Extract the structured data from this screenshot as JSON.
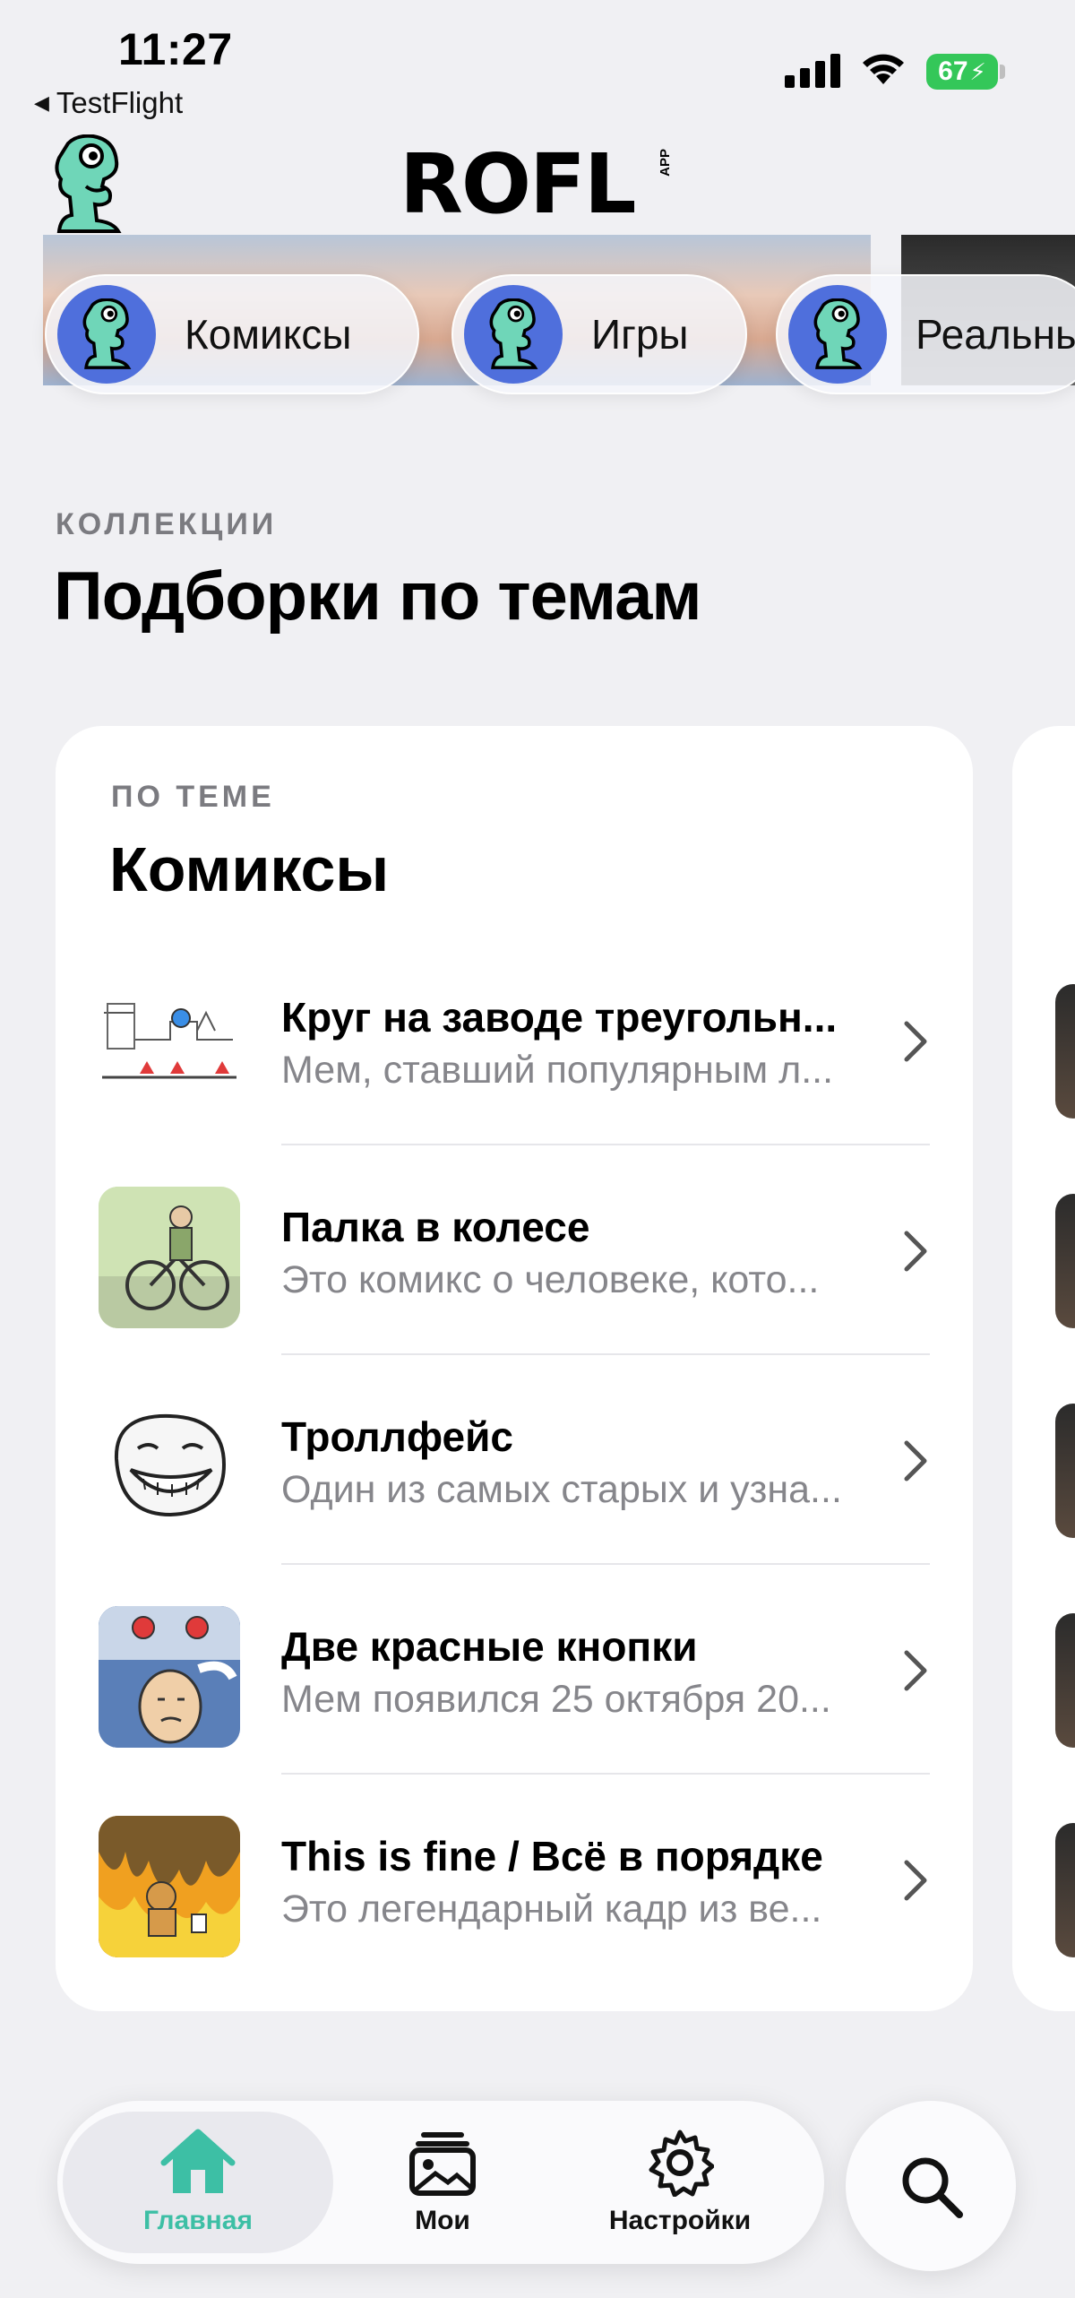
{
  "status_bar": {
    "time": "11:27",
    "back_app": "TestFlight",
    "battery": "67"
  },
  "header": {
    "brand": "ROFL",
    "brand_suffix": "APP",
    "logo_icon": "dino-mascot-icon"
  },
  "categories": [
    {
      "label": "Комиксы",
      "icon": "dino-mascot-icon"
    },
    {
      "label": "Игры",
      "icon": "dino-mascot-icon"
    },
    {
      "label": "Реальны",
      "icon": "dino-mascot-icon"
    }
  ],
  "collections": {
    "kicker": "КОЛЛЕКЦИИ",
    "title": "Подборки по темам"
  },
  "card": {
    "kicker": "ПО ТЕМЕ",
    "title": "Комиксы",
    "items": [
      {
        "title": "Круг на заводе треугольн...",
        "subtitle": "Мем, ставший популярным л..."
      },
      {
        "title": "Палка в колесе",
        "subtitle": "Это комикс о человеке, кото..."
      },
      {
        "title": "Троллфейс",
        "subtitle": "Один из самых старых и узна..."
      },
      {
        "title": "Две красные кнопки",
        "subtitle": "Мем появился 25 октября 20..."
      },
      {
        "title": "This is fine / Всё в порядке",
        "subtitle": "Это легендарный кадр из ве..."
      }
    ]
  },
  "tabbar": {
    "tabs": [
      {
        "label": "Главная",
        "icon": "home-icon",
        "active": true
      },
      {
        "label": "Мои",
        "icon": "gallery-icon",
        "active": false
      },
      {
        "label": "Настройки",
        "icon": "gear-icon",
        "active": false
      }
    ],
    "search_icon": "search-icon"
  },
  "colors": {
    "accent": "#3dbfa5",
    "mascot": "#6fd6b8",
    "chip_avatar": "#4f6fdc",
    "background": "#f0f0f3"
  }
}
